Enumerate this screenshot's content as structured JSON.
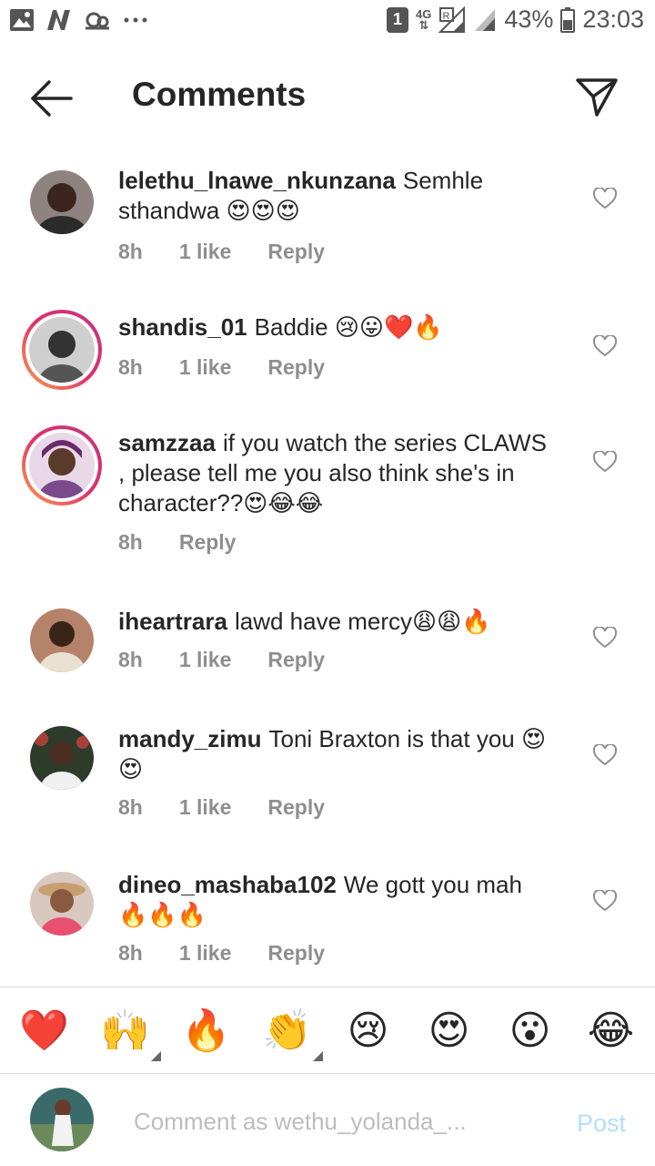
{
  "status_bar": {
    "sim_slot": "1",
    "network": "4G",
    "battery_percent": "43%",
    "time": "23:03"
  },
  "header": {
    "title": "Comments"
  },
  "comments": [
    {
      "username": "lelethu_lnawe_nkunzana",
      "text": "Semhle sthandwa 😍😍😍",
      "time": "8h",
      "likes": "1 like",
      "reply_label": "Reply",
      "story_ring": false,
      "avatar_color": "#7a6a66"
    },
    {
      "username": "shandis_01",
      "text": "Baddie 😢😛❤️🔥",
      "time": "8h",
      "likes": "1 like",
      "reply_label": "Reply",
      "story_ring": true,
      "avatar_color": "#9a9a9a"
    },
    {
      "username": "samzzaa",
      "text": "if you watch the series CLAWS , please tell  me you also think she's in character??😍😂😂",
      "time": "8h",
      "likes": "",
      "reply_label": "Reply",
      "story_ring": true,
      "avatar_color": "#6b4a6a"
    },
    {
      "username": "iheartrara",
      "text": "lawd have mercy😩😩🔥",
      "time": "8h",
      "likes": "1 like",
      "reply_label": "Reply",
      "story_ring": false,
      "avatar_color": "#a5705a"
    },
    {
      "username": "mandy_zimu",
      "text": "Toni Braxton is that you 😍😍",
      "time": "8h",
      "likes": "1 like",
      "reply_label": "Reply",
      "story_ring": false,
      "avatar_color": "#3d4a3a"
    },
    {
      "username": "dineo_mashaba102",
      "text": "We gott you mah 🔥🔥🔥",
      "time": "8h",
      "likes": "1 like",
      "reply_label": "Reply",
      "story_ring": false,
      "avatar_color": "#8c5a4a"
    }
  ],
  "quick_emojis": [
    "❤️",
    "🙌",
    "🔥",
    "👏",
    "😢",
    "😍",
    "😮",
    "😂"
  ],
  "composer": {
    "placeholder": "Comment as wethu_yolanda_...",
    "post_label": "Post"
  },
  "colors": {
    "meta_gray": "#8e8e8e",
    "post_disabled": "#b2dffc",
    "story_ring_start": "#f7a34b",
    "story_ring_end": "#c13584"
  }
}
